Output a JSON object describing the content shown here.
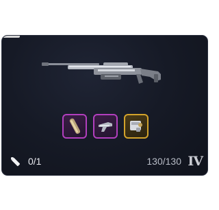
{
  "weapon_card": {
    "weapon_name": "sniper-rifle",
    "ammo": "0/1",
    "durability": "130/130",
    "tier": "IV",
    "attachments": [
      {
        "name": "barrel-attachment-icon",
        "rarity_color": "#b23fbe"
      },
      {
        "name": "stock-attachment-icon",
        "rarity_color": "#b23fbe"
      },
      {
        "name": "scope-attachment-icon",
        "rarity_color": "#d3a32b"
      }
    ]
  }
}
